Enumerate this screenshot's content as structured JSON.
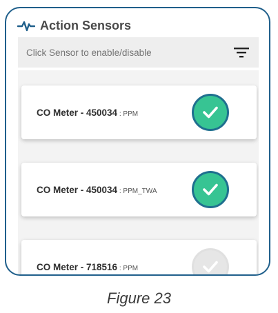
{
  "header": {
    "title": "Action Sensors",
    "icon": "pulse-icon"
  },
  "filter": {
    "hint": "Click Sensor to enable/disable",
    "icon": "filter-icon"
  },
  "sensors": [
    {
      "name": "CO Meter - 450034",
      "separator": " : ",
      "unit": "PPM",
      "enabled": true
    },
    {
      "name": "CO Meter - 450034",
      "separator": " : ",
      "unit": "PPM_TWA",
      "enabled": true
    },
    {
      "name": "CO Meter - 718516",
      "separator": " : ",
      "unit": "PPM",
      "enabled": false
    }
  ],
  "colors": {
    "frame_border": "#1f5f8b",
    "pulse_icon": "#1f5f8b",
    "check_enabled_fill": "#37c493",
    "check_enabled_border": "#1f6f8f",
    "check_disabled_fill": "#e6e6e6"
  },
  "caption": "Figure 23"
}
